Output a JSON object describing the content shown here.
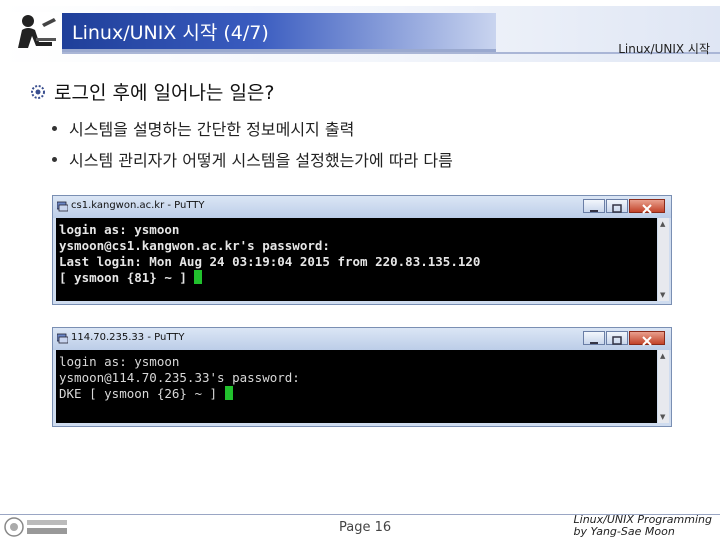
{
  "header": {
    "title": "Linux/UNIX 시작 (4/7)",
    "right_label": "Linux/UNIX 시작"
  },
  "content": {
    "heading": "로그인 후에 일어나는 일은?",
    "bullets": [
      "시스템을 설명하는 간단한 정보메시지 출력",
      "시스템 관리자가 어떻게 시스템을 설정했는가에 따라 다름"
    ]
  },
  "windows": [
    {
      "title": "cs1.kangwon.ac.kr - PuTTY",
      "lines": [
        "login as: ysmoon",
        "ysmoon@cs1.kangwon.ac.kr's password:",
        "Last login: Mon Aug 24 03:19:04 2015 from 220.83.135.120",
        "[ ysmoon {81} ~ ] "
      ]
    },
    {
      "title": "114.70.235.33 - PuTTY",
      "lines": [
        "login as: ysmoon",
        "ysmoon@114.70.235.33's password:",
        "DKE [ ysmoon {26} ~ ] "
      ]
    }
  ],
  "footer": {
    "page": "Page 16",
    "course_line1": "Linux/UNIX Programming",
    "course_line2": "by Yang-Sae Moon"
  },
  "icons": {
    "window_close": "x-icon",
    "window_minimize": "minimize-icon",
    "window_maximize": "maximize-icon"
  },
  "colors": {
    "title_box": "#1f3f99",
    "cursor": "#21c12d"
  }
}
